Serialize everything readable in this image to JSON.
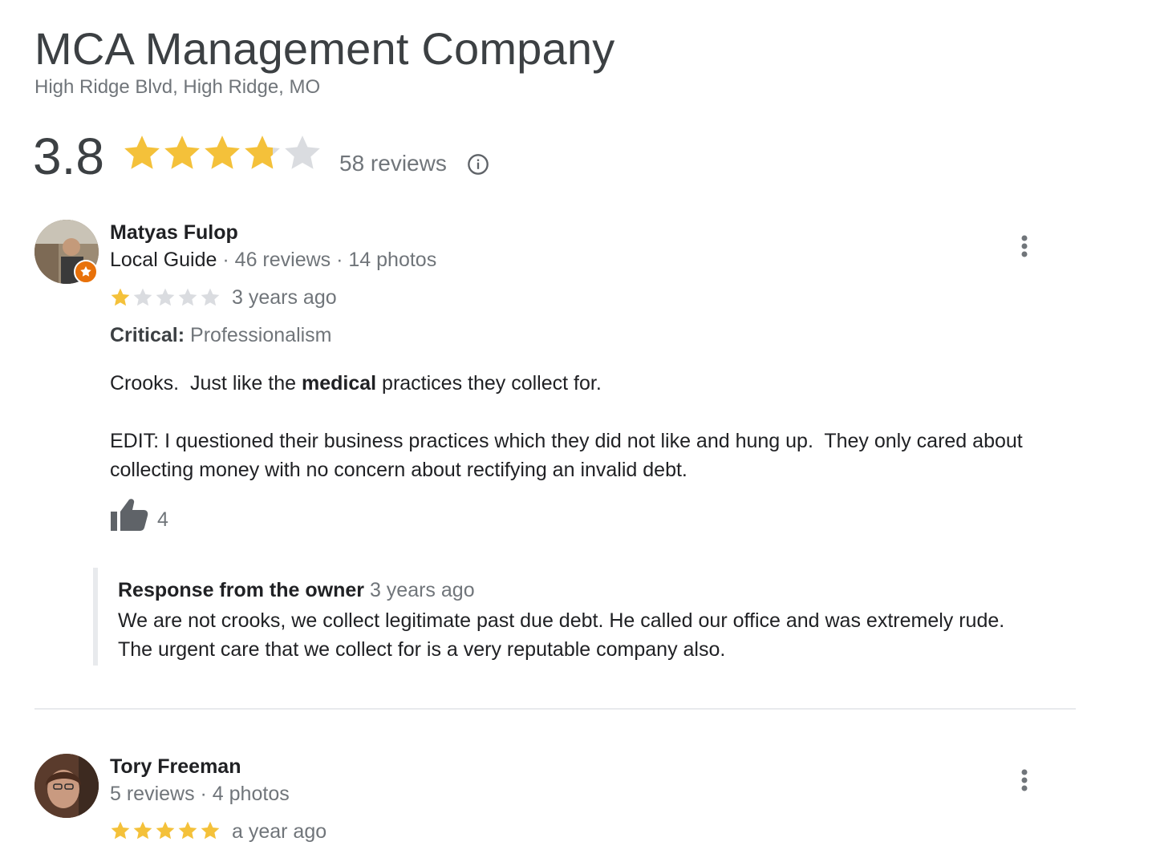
{
  "business": {
    "name": "MCA Management Company",
    "address": "High Ridge Blvd, High Ridge, MO",
    "rating": "3.8",
    "rating_value": 3.8,
    "reviews_count": "58 reviews"
  },
  "colors": {
    "star_filled": "#f4c13a",
    "star_empty": "#dadce0",
    "muted_text": "#70757a"
  },
  "icons": {
    "info": "info-circle-icon",
    "more": "more-vert-icon",
    "like": "thumb-up-icon"
  },
  "reviews": [
    {
      "author": "Matyas Fulop",
      "badge": "Local Guide",
      "meta": "46 reviews · 14 photos",
      "stars": 1,
      "time": "3 years ago",
      "critical_label": "Critical:",
      "critical_value": "Professionalism",
      "text_part1": "Crooks.  Just like the ",
      "text_bold": "medical",
      "text_part2": " practices they collect for.",
      "edit_line1": "EDIT: I questioned their business practices which they did not like and hung up.  They only cared about",
      "edit_line2": "collecting money with no concern about rectifying an invalid debt.",
      "likes": "4",
      "owner_response": {
        "label": "Response from the owner",
        "time": "3 years ago",
        "line1": "We are not crooks, we collect legitimate past due debt. He called our office and was extremely rude.",
        "line2": "The urgent care that we collect for is a very reputable company also."
      }
    },
    {
      "author": "Tory Freeman",
      "meta": "5 reviews · 4 photos",
      "stars": 5,
      "time": "a year ago"
    }
  ]
}
